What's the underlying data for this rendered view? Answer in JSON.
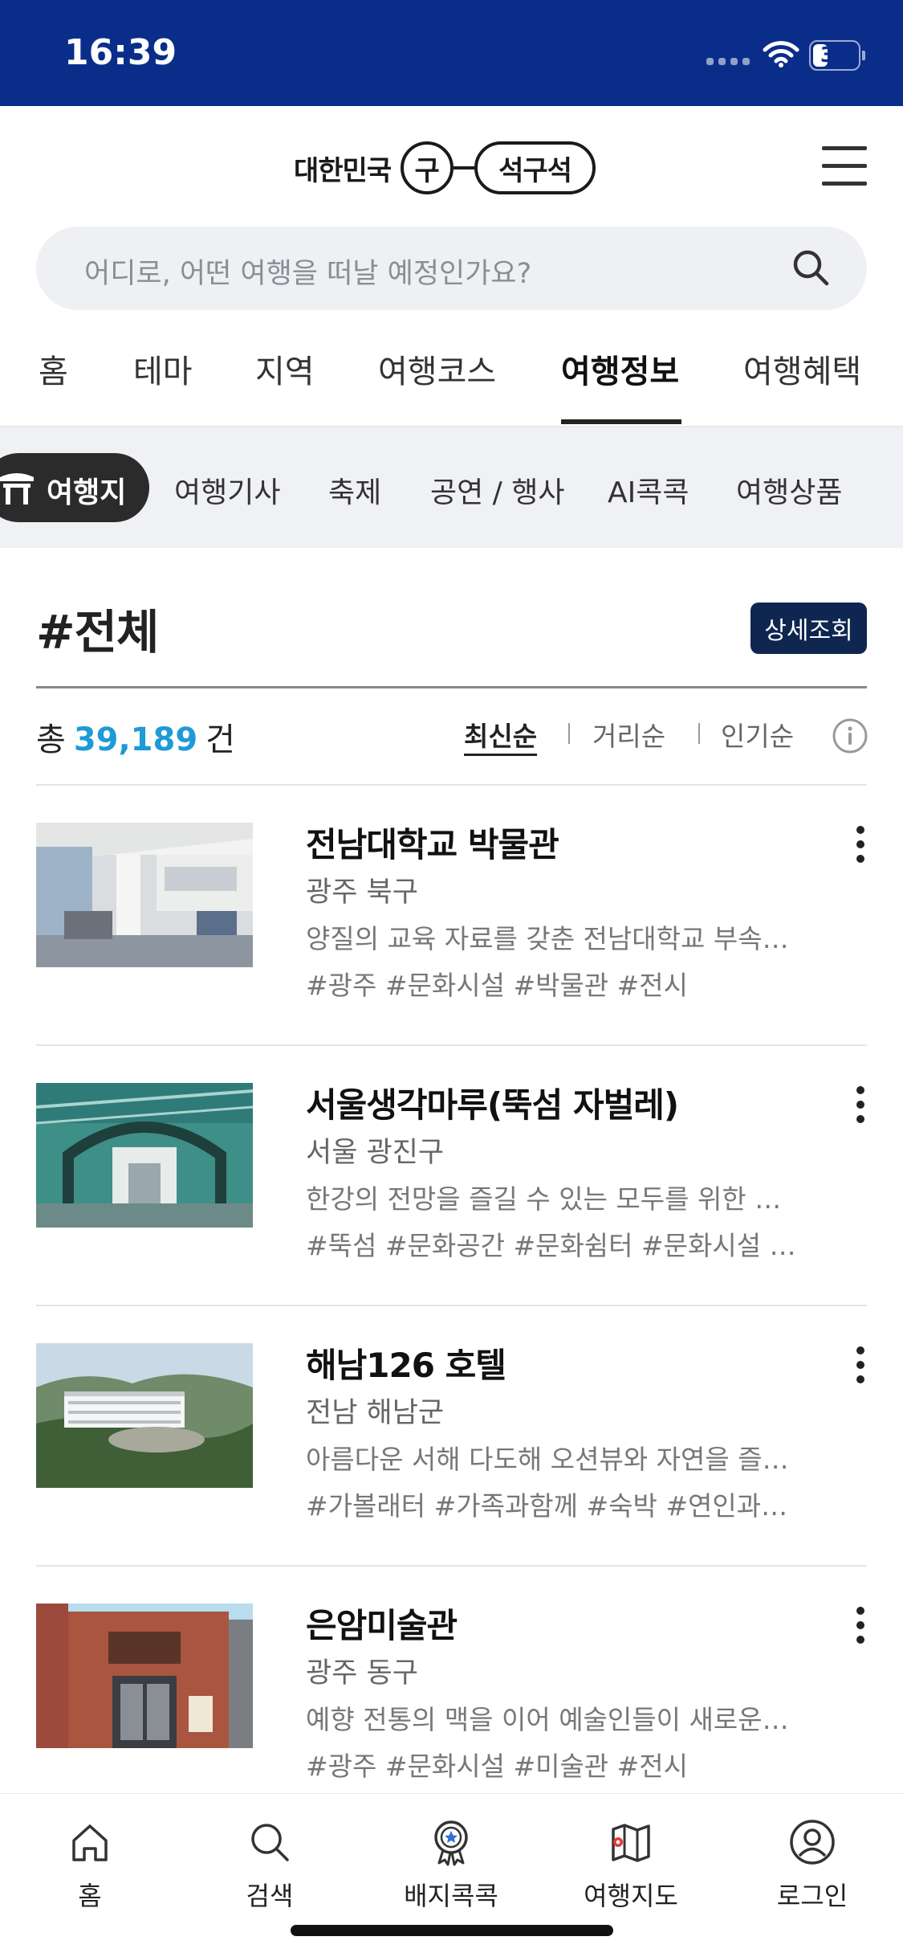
{
  "status_bar": {
    "time": "16:39",
    "battery": "31",
    "battery_level": 0.31
  },
  "header": {
    "logo_prefix": "대한민국",
    "logo_circle": "구",
    "logo_pill": "석구석"
  },
  "search": {
    "placeholder": "어디로, 어떤 여행을 떠날 예정인가요?"
  },
  "main_tabs": [
    {
      "label": "홈"
    },
    {
      "label": "테마"
    },
    {
      "label": "지역"
    },
    {
      "label": "여행코스"
    },
    {
      "label": "여행정보",
      "active": true
    },
    {
      "label": "여행혜택"
    }
  ],
  "sub_tabs": [
    {
      "label": "여행지",
      "active": true
    },
    {
      "label": "여행기사"
    },
    {
      "label": "축제"
    },
    {
      "label": "공연 / 행사"
    },
    {
      "label": "AI콕콕"
    },
    {
      "label": "여행상품"
    }
  ],
  "section": {
    "title": "#전체",
    "detail_button": "상세조회",
    "total_prefix": "총",
    "total_count": "39,189",
    "total_suffix": "건"
  },
  "sort": [
    {
      "label": "최신순",
      "active": true
    },
    {
      "label": "거리순"
    },
    {
      "label": "인기순"
    }
  ],
  "items": [
    {
      "title": "전남대학교 박물관",
      "region": "광주 북구",
      "desc": "양질의 교육 자료를 갖춘 전남대학교 부속 …",
      "tags": "#광주  #문화시설  #박물관  #전시"
    },
    {
      "title": "서울생각마루(뚝섬 자벌레)",
      "region": "서울 광진구",
      "desc": "한강의 전망을 즐길 수 있는 모두를 위한 문…",
      "tags": "#뚝섬  #문화공간  #문화쉼터  #문화시설  …"
    },
    {
      "title": "해남126 호텔",
      "region": "전남 해남군",
      "desc": "아름다운 서해 다도해 오션뷰와 자연을 즐기…",
      "tags": "#가볼래터  #가족과함께  #숙박  #연인과…"
    },
    {
      "title": "은암미술관",
      "region": "광주 동구",
      "desc": "예향 전통의 맥을 이어 예술인들이 새로운 …",
      "tags": "#광주  #문화시설  #미술관  #전시"
    }
  ],
  "bottom_nav": [
    {
      "label": "홈",
      "icon": "home-icon"
    },
    {
      "label": "검색",
      "icon": "search-icon"
    },
    {
      "label": "배지콕콕",
      "icon": "badge-icon"
    },
    {
      "label": "여행지도",
      "icon": "map-icon"
    },
    {
      "label": "로그인",
      "icon": "user-icon"
    }
  ],
  "colors": {
    "status_bar": "#0b2d8a",
    "accent_count": "#1e9ad6",
    "detail_button": "#0e2650",
    "active_chip": "#2b2b2b"
  }
}
